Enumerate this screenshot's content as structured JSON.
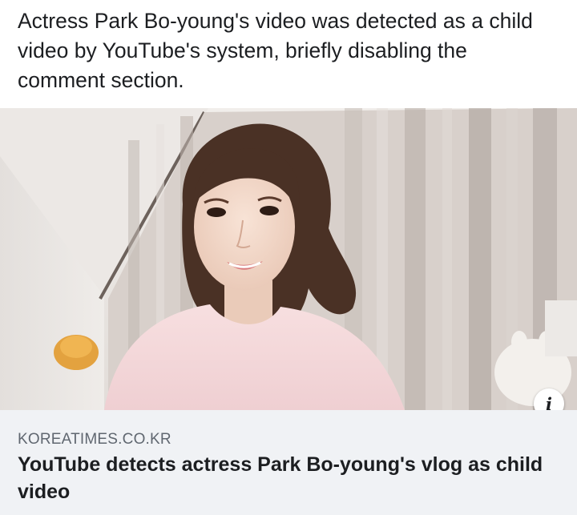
{
  "post": {
    "text": "Actress Park Bo-young's video was detected as a child video by YouTube's system, briefly disabling the comment section."
  },
  "link_preview": {
    "domain": "KOREATIMES.CO.KR",
    "headline": "YouTube detects actress Park Bo-young's vlog as child video",
    "info_icon": "info-icon",
    "info_glyph": "i"
  },
  "colors": {
    "meta_background": "#f0f2f5",
    "domain_text": "#606770",
    "headline_text": "#1c1e21"
  }
}
